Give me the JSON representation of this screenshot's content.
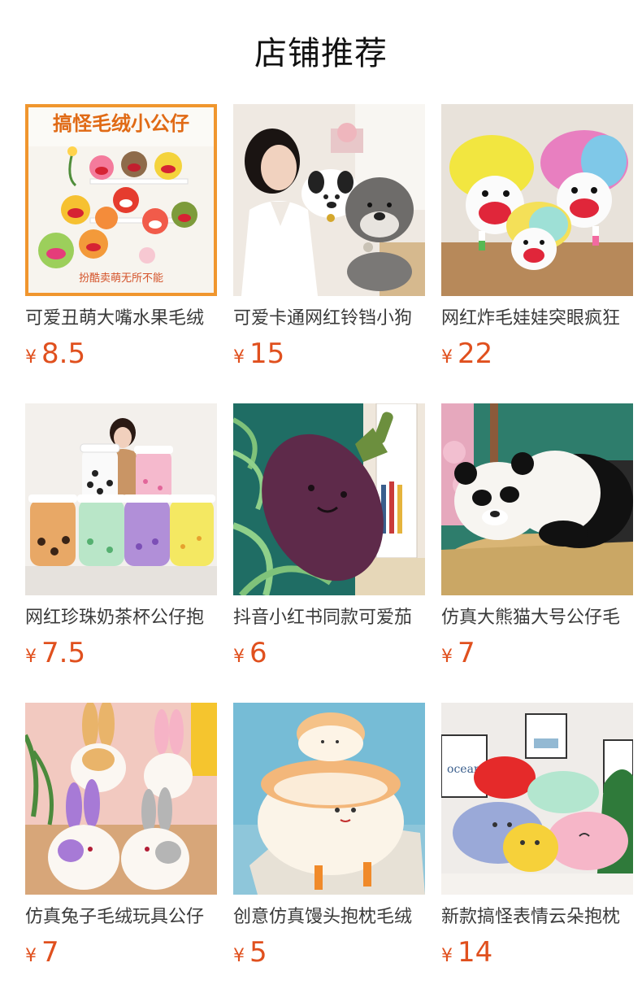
{
  "page_title": "店铺推荐",
  "currency_symbol": "¥",
  "colors": {
    "price": "#e0501e",
    "title_text": "#111111",
    "name_text": "#3a3a3a",
    "first_image_border": "#f0962e",
    "first_image_banner_text": "#e06a15"
  },
  "products": [
    {
      "name": "可爱丑萌大嘴水果毛绒",
      "price": "8.5",
      "image": "fruit-plush-toys-image",
      "banner_text": "搞怪毛绒小公仔",
      "caption_text": "扮酷卖萌无所不能"
    },
    {
      "name": "可爱卡通网红铃铛小狗",
      "price": "15",
      "image": "puppy-plush-with-model-image"
    },
    {
      "name": "网红炸毛娃娃突眼疯狂",
      "price": "22",
      "image": "fluffy-hair-doll-image"
    },
    {
      "name": "网红珍珠奶茶杯公仔抱",
      "price": "7.5",
      "image": "bubble-tea-plush-image"
    },
    {
      "name": "抖音小红书同款可爱茄",
      "price": "6",
      "image": "eggplant-plush-image"
    },
    {
      "name": "仿真大熊猫大号公仔毛",
      "price": "7",
      "image": "panda-plush-image"
    },
    {
      "name": "仿真兔子毛绒玩具公仔",
      "price": "7",
      "image": "bunny-plush-image"
    },
    {
      "name": "创意仿真馒头抱枕毛绒",
      "price": "5",
      "image": "steamed-bun-plush-image"
    },
    {
      "name": "新款搞怪表情云朵抱枕",
      "price": "14",
      "image": "cloud-pillow-plush-image",
      "poster_text": "ocean"
    }
  ]
}
